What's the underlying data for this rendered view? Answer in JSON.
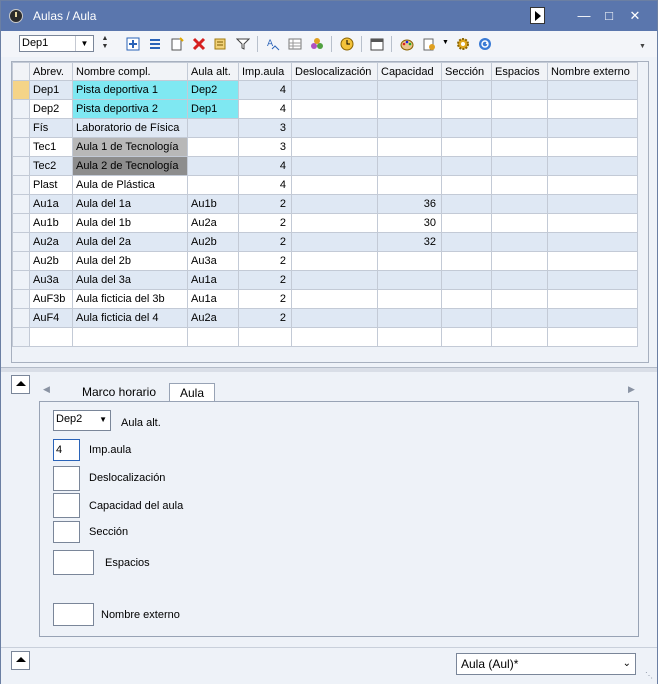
{
  "window": {
    "title": "Aulas / Aula"
  },
  "toolbar": {
    "combo_value": "Dep1",
    "icons": [
      "new-row-icon",
      "list-icon",
      "new-doc-icon",
      "delete-icon",
      "sort-icon",
      "filter-icon",
      "spell-icon",
      "table-icon",
      "merge-icon",
      "clock-icon",
      "calendar-icon",
      "palette-icon",
      "settings-dropdown-icon",
      "gear-icon",
      "refresh-icon"
    ]
  },
  "grid": {
    "columns": [
      "Abrev.",
      "Nombre compl.",
      "Aula alt.",
      "Imp.aula",
      "Deslocalización",
      "Capacidad",
      "Sección",
      "Espacios",
      "Nombre externo"
    ],
    "rows": [
      {
        "abrev": "Dep1",
        "nombre": "Pista deportiva 1",
        "aula_alt": "Dep2",
        "imp": "4",
        "desloc": "",
        "cap": "",
        "seccion": "",
        "espacios": "",
        "externo": ""
      },
      {
        "abrev": "Dep2",
        "nombre": "Pista deportiva 2",
        "aula_alt": "Dep1",
        "imp": "4",
        "desloc": "",
        "cap": "",
        "seccion": "",
        "espacios": "",
        "externo": ""
      },
      {
        "abrev": "Fís",
        "nombre": "Laboratorio de Física",
        "aula_alt": "",
        "imp": "3",
        "desloc": "",
        "cap": "",
        "seccion": "",
        "espacios": "",
        "externo": ""
      },
      {
        "abrev": "Tec1",
        "nombre": "Aula 1 de Tecnología",
        "aula_alt": "",
        "imp": "3",
        "desloc": "",
        "cap": "",
        "seccion": "",
        "espacios": "",
        "externo": ""
      },
      {
        "abrev": "Tec2",
        "nombre": "Aula 2 de Tecnología",
        "aula_alt": "",
        "imp": "4",
        "desloc": "",
        "cap": "",
        "seccion": "",
        "espacios": "",
        "externo": ""
      },
      {
        "abrev": "Plast",
        "nombre": "Aula de Plástica",
        "aula_alt": "",
        "imp": "4",
        "desloc": "",
        "cap": "",
        "seccion": "",
        "espacios": "",
        "externo": ""
      },
      {
        "abrev": "Au1a",
        "nombre": "Aula del 1a",
        "aula_alt": "Au1b",
        "imp": "2",
        "desloc": "",
        "cap": "36",
        "seccion": "",
        "espacios": "",
        "externo": ""
      },
      {
        "abrev": "Au1b",
        "nombre": "Aula del 1b",
        "aula_alt": "Au2a",
        "imp": "2",
        "desloc": "",
        "cap": "30",
        "seccion": "",
        "espacios": "",
        "externo": ""
      },
      {
        "abrev": "Au2a",
        "nombre": "Aula del 2a",
        "aula_alt": "Au2b",
        "imp": "2",
        "desloc": "",
        "cap": "32",
        "seccion": "",
        "espacios": "",
        "externo": ""
      },
      {
        "abrev": "Au2b",
        "nombre": "Aula del 2b",
        "aula_alt": "Au3a",
        "imp": "2",
        "desloc": "",
        "cap": "",
        "seccion": "",
        "espacios": "",
        "externo": ""
      },
      {
        "abrev": "Au3a",
        "nombre": "Aula del 3a",
        "aula_alt": "Au1a",
        "imp": "2",
        "desloc": "",
        "cap": "",
        "seccion": "",
        "espacios": "",
        "externo": ""
      },
      {
        "abrev": "AuF3b",
        "nombre": "Aula ficticia del 3b",
        "aula_alt": "Au1a",
        "imp": "2",
        "desloc": "",
        "cap": "",
        "seccion": "",
        "espacios": "",
        "externo": ""
      },
      {
        "abrev": "AuF4",
        "nombre": "Aula ficticia del 4",
        "aula_alt": "Au2a",
        "imp": "2",
        "desloc": "",
        "cap": "",
        "seccion": "",
        "espacios": "",
        "externo": ""
      },
      {
        "abrev": "",
        "nombre": "",
        "aula_alt": "",
        "imp": "",
        "desloc": "",
        "cap": "",
        "seccion": "",
        "espacios": "",
        "externo": ""
      }
    ],
    "name_colors": {
      "Dep1": "cyan",
      "Dep2": "cyan",
      "Tec1": "gray1",
      "Tec2": "gray2"
    },
    "alt_colors": {
      "Dep1": "cyan",
      "Dep2": "cyan"
    },
    "selected_row": 0
  },
  "tabs": [
    {
      "label": "Marco horario",
      "active": false
    },
    {
      "label": "Aula",
      "active": true
    }
  ],
  "detail": {
    "aula_alt_value": "Dep2",
    "aula_alt_label": "Aula alt.",
    "imp_value": "4",
    "imp_label": "Imp.aula",
    "desloc_label": "Deslocalización",
    "capacidad_label": "Capacidad del aula",
    "seccion_label": "Sección",
    "espacios_label": "Espacios",
    "externo_label": "Nombre externo"
  },
  "status": {
    "view_value": "Aula (Aul)*"
  },
  "colors": {
    "title_bar": "#5a76ad",
    "row_alt": "#dfe8f4",
    "cyan": "#7fe8f2",
    "gray1": "#b8b8b8",
    "gray2": "#8d8d8d",
    "selected_indicator": "#f5d488"
  }
}
